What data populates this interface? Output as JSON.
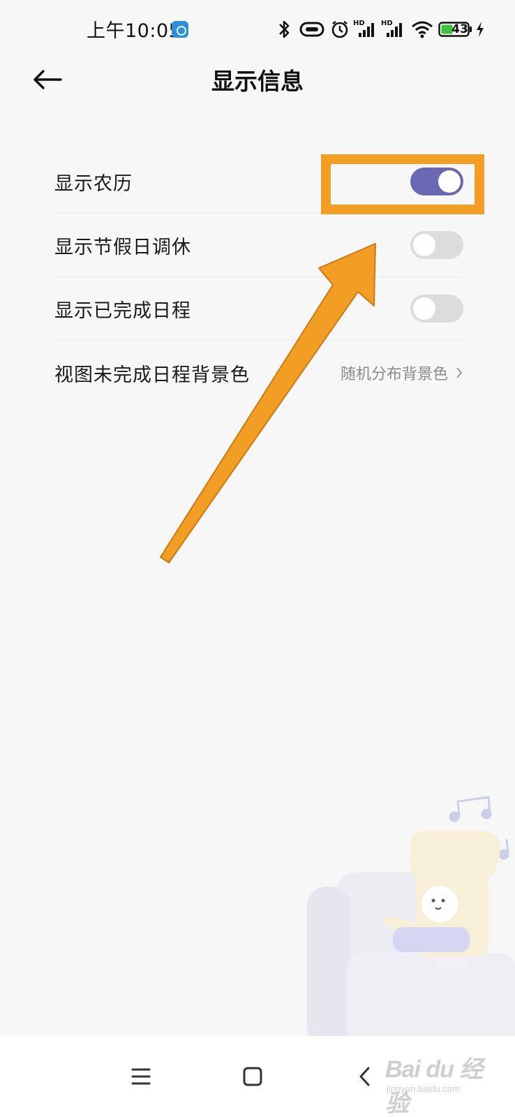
{
  "status_bar": {
    "time": "上午10:05",
    "network_labels": [
      "HD",
      "HD"
    ],
    "battery_level": "43",
    "icons": [
      "app-notification-icon",
      "bluetooth-icon",
      "nfc-icon",
      "alarm-icon",
      "signal-icon",
      "signal-icon",
      "wifi-icon",
      "battery-icon",
      "charging-icon"
    ]
  },
  "header": {
    "back_icon": "back-arrow-icon",
    "title": "显示信息"
  },
  "settings": [
    {
      "label": "显示农历",
      "type": "toggle",
      "enabled": true
    },
    {
      "label": "显示节假日调休",
      "type": "toggle",
      "enabled": false
    },
    {
      "label": "显示已完成日程",
      "type": "toggle",
      "enabled": false
    },
    {
      "label": "视图未完成日程背景色",
      "type": "select",
      "value": "随机分布背景色"
    }
  ],
  "colors": {
    "accent": "#6a68b2",
    "toggle_off": "#dcdcde",
    "background": "#f7f7f8",
    "annotation": "#f29d23"
  },
  "annotation": {
    "type": "highlight-box-and-arrow",
    "target": "显示农历 toggle"
  },
  "nav_bar": {
    "buttons": [
      "menu-icon",
      "home-icon",
      "back-icon"
    ]
  },
  "watermark": {
    "text": "Bai du 经验",
    "subtext": "jingyan.baidu.com"
  }
}
